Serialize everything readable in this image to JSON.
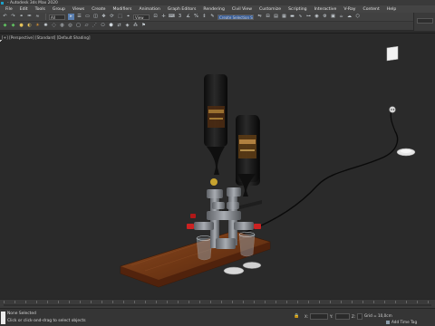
{
  "window": {
    "title": "- Autodesk 3ds Max 2020"
  },
  "menubar": {
    "items": [
      "File",
      "Edit",
      "Tools",
      "Group",
      "Views",
      "Create",
      "Modifiers",
      "Animation",
      "Graph Editors",
      "Rendering",
      "Civil View",
      "Customize",
      "Scripting",
      "Interactive",
      "V-Ray",
      "Content",
      "Help"
    ],
    "workspaces_label": "Workspaces:"
  },
  "toolbar": {
    "filter_value": "All",
    "view_value": "View",
    "selection_set_value": "Create Selection Se"
  },
  "viewport": {
    "label": "[+] [Perspective] [Standard] [Default Shading]"
  },
  "status": {
    "selection": "None Selected",
    "prompt": "Click or click-and-drag to select objects",
    "x_label": "X:",
    "y_label": "Y:",
    "z_label": "Z:",
    "grid": "Grid = 10,0cm",
    "add_time_tag": "Add Time Tag"
  },
  "colors": {
    "accent": "#3a5f9a",
    "viewport_bg": "#2a2a2a"
  }
}
